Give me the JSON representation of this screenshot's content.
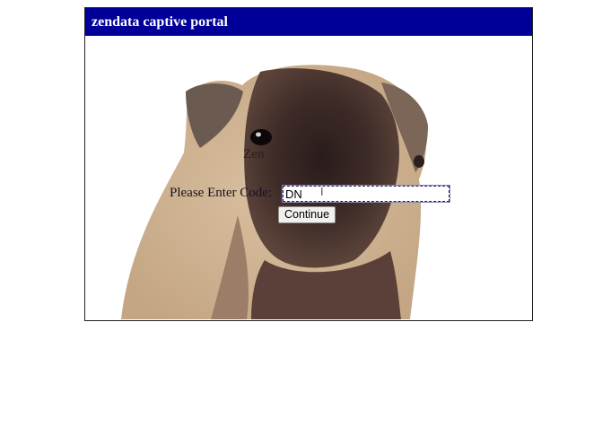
{
  "portal": {
    "title": "zendata captive portal",
    "welcome_text": "Zen",
    "code_label": "Please Enter Code:",
    "code_input_value": "DN",
    "continue_label": "Continue",
    "background_image": "pug-photo"
  },
  "colors": {
    "header_bg": "#000099",
    "header_text": "#ffffff"
  }
}
